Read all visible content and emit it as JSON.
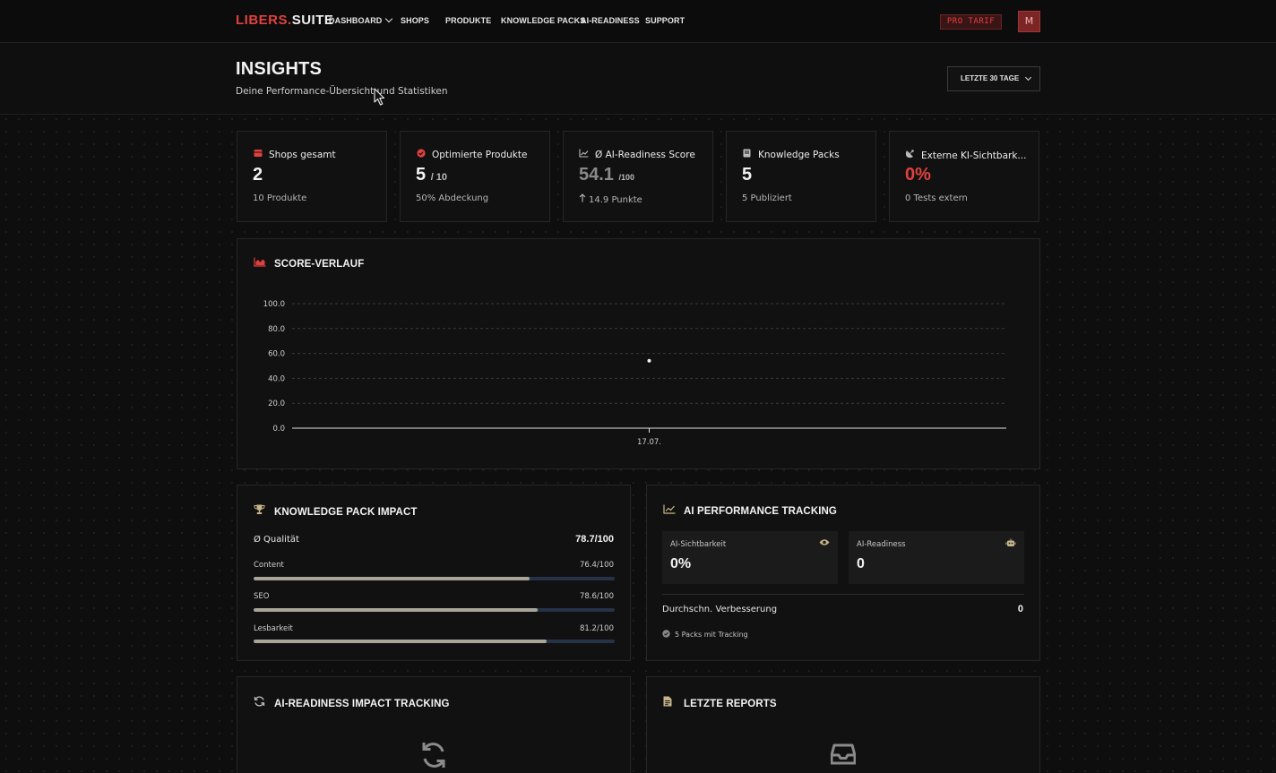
{
  "nav": {
    "logo_part1": "LIBERS",
    "logo_part2": "SUITE",
    "items": [
      {
        "label": "DASHBOARD",
        "has_dropdown": true
      },
      {
        "label": "SHOPS"
      },
      {
        "label": "PRODUKTE"
      },
      {
        "label": "KNOWLEDGE PACKS"
      },
      {
        "label": "AI-READINESS"
      },
      {
        "label": "SUPPORT"
      }
    ],
    "plan_badge": "PRO TARIF",
    "avatar_initial": "M"
  },
  "header": {
    "title": "INSIGHTS",
    "subtitle": "Deine Performance-Übersicht und Statistiken",
    "period_selected": "LETZTE 30 TAGE"
  },
  "stats": [
    {
      "icon": "store-icon",
      "label": "Shops gesamt",
      "value": "2",
      "suffix": "",
      "sub": "10 Produkte"
    },
    {
      "icon": "check-circle-icon",
      "label": "Optimierte Produkte",
      "value": "5",
      "suffix": "/ 10",
      "sub": "50% Abdeckung"
    },
    {
      "icon": "line-chart-icon",
      "label": "Ø AI-Readiness Score",
      "value": "54.1",
      "suffix": "/100",
      "sub": "14.9 Punkte",
      "trend": "up"
    },
    {
      "icon": "book-icon",
      "label": "Knowledge Packs",
      "value": "5",
      "suffix": "",
      "sub": "5 Publiziert"
    },
    {
      "icon": "satellite-icon",
      "label": "Externe KI-Sichtbark...",
      "value": "0%",
      "suffix": "",
      "sub": "0 Tests extern"
    }
  ],
  "score_chart": {
    "title": "SCORE-VERLAUF"
  },
  "chart_data": {
    "type": "line",
    "x": [
      "17.07."
    ],
    "series": [
      {
        "values": [
          54.1
        ]
      }
    ],
    "xlabel": "",
    "ylabel": "",
    "ylim": [
      0,
      100
    ],
    "yticks": [
      "100.0",
      "80.0",
      "60.0",
      "40.0",
      "20.0",
      "0.0"
    ],
    "grid": true
  },
  "kp_impact": {
    "title": "KNOWLEDGE PACK IMPACT",
    "quality_label": "Ø Qualität",
    "quality_value": "78.7/100",
    "bars": [
      {
        "label": "Content",
        "value_text": "76.4/100",
        "value": 76.4
      },
      {
        "label": "SEO",
        "value_text": "78.6/100",
        "value": 78.6
      },
      {
        "label": "Lesbarkeit",
        "value_text": "81.2/100",
        "value": 81.2
      }
    ]
  },
  "ai_tracking": {
    "title": "AI PERFORMANCE TRACKING",
    "visibility_label": "AI-Sichtbarkeit",
    "visibility_value": "0%",
    "readiness_label": "AI-Readiness",
    "readiness_value": "0",
    "improvement_label": "Durchschn. Verbesserung",
    "improvement_value": "0",
    "packs_tracking": "5 Packs mit Tracking"
  },
  "ai_impact": {
    "title": "AI-READINESS IMPACT TRACKING"
  },
  "reports": {
    "title": "LETZTE REPORTS"
  },
  "colors": {
    "accent_red": "#e0413f",
    "bar_fill": "#a7a699",
    "bar_track": "#263247",
    "icon_gold": "#c8b48a"
  }
}
